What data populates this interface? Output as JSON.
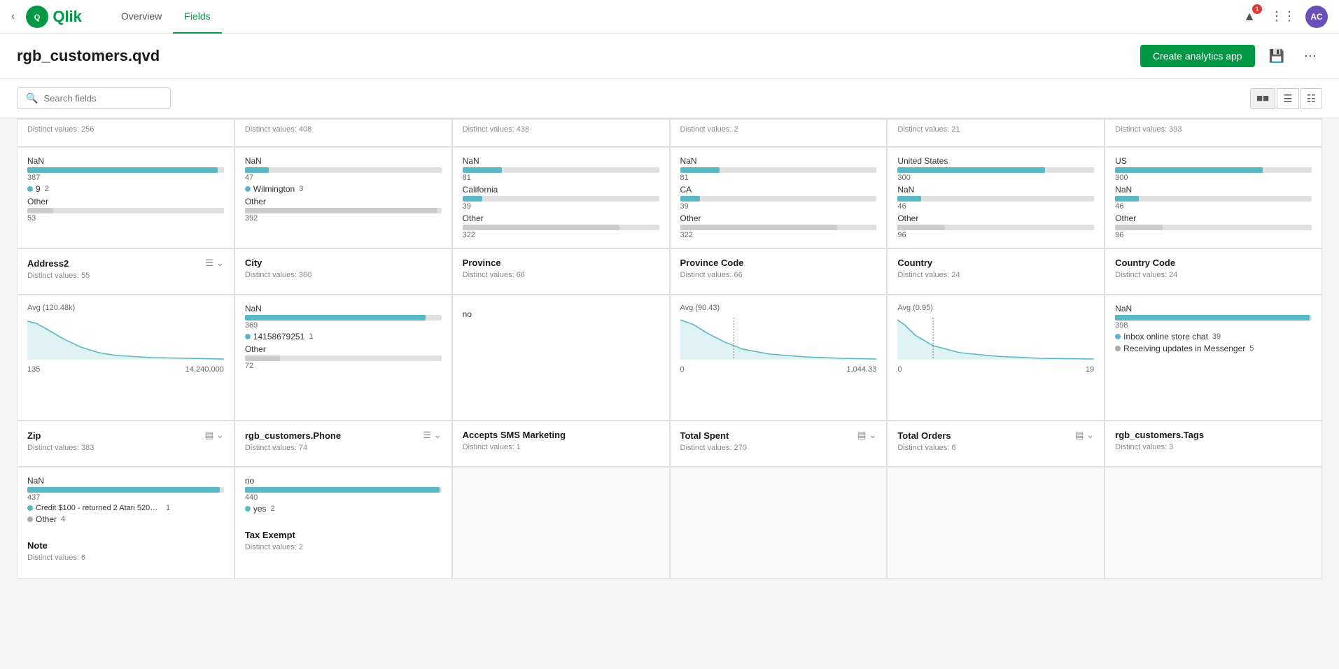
{
  "app": {
    "title": "rgb_customers.qvd"
  },
  "header": {
    "back_label": "‹",
    "logo_text": "Qlik",
    "logo_icon_text": "Q",
    "nav": [
      {
        "label": "Overview",
        "active": false
      },
      {
        "label": "Fields",
        "active": true
      }
    ],
    "notification_count": "1",
    "avatar_text": "AC"
  },
  "toolbar": {
    "search_placeholder": "Search fields",
    "create_analytics_label": "Create analytics app"
  },
  "fields": [
    {
      "name": "Address2",
      "distinct_label": "Distinct values: 55",
      "type": "text",
      "values": [
        {
          "label": "NaN",
          "count": 387,
          "max": 400,
          "type": "bar"
        },
        {
          "label": "9",
          "count": 2,
          "type": "dot"
        },
        {
          "label": "Other",
          "count": 53,
          "type": "bar_gray"
        }
      ],
      "has_sort": true
    },
    {
      "name": "City",
      "distinct_label": "Distinct values: 360",
      "type": "text",
      "values": [
        {
          "label": "NaN",
          "count": 47,
          "type": "bar"
        },
        {
          "label": "Wilmington",
          "count": 3,
          "type": "dot"
        },
        {
          "label": "Other",
          "count": 392,
          "type": "bar_gray"
        }
      ],
      "has_sort": true
    },
    {
      "name": "Province",
      "distinct_label": "Distinct values: 66",
      "type": "text",
      "values": [
        {
          "label": "NaN",
          "count": 81,
          "type": "bar"
        },
        {
          "label": "California",
          "count": 39,
          "type": "bar_teal_small"
        },
        {
          "label": "Other",
          "count": 322,
          "type": "bar_gray"
        }
      ],
      "has_sort": true
    },
    {
      "name": "Province Code",
      "distinct_label": "Distinct values: 66",
      "type": "text",
      "values": [
        {
          "label": "NaN",
          "count": 81,
          "type": "bar"
        },
        {
          "label": "CA",
          "count": 39,
          "type": "bar_teal_small"
        },
        {
          "label": "Other",
          "count": 322,
          "type": "bar_gray"
        }
      ],
      "has_sort": true
    },
    {
      "name": "Country",
      "distinct_label": "Distinct values: 24",
      "type": "text",
      "values": [
        {
          "label": "United States",
          "count": 300,
          "type": "bar"
        },
        {
          "label": "NaN",
          "count": 46,
          "type": "bar_teal_small"
        },
        {
          "label": "Other",
          "count": 96,
          "type": "bar_gray"
        }
      ],
      "has_sort": true
    },
    {
      "name": "Country Code",
      "distinct_label": "Distinct values: 24",
      "type": "text",
      "values": [
        {
          "label": "US",
          "count": 300,
          "type": "bar"
        },
        {
          "label": "NaN",
          "count": 46,
          "type": "bar_teal_small"
        },
        {
          "label": "Other",
          "count": 96,
          "type": "bar_gray"
        }
      ],
      "has_sort": true
    },
    {
      "name": "Zip",
      "distinct_label": "Distinct values: 383",
      "type": "numeric",
      "avg": "Avg (120.48k)",
      "range_min": "135",
      "range_max": "14,240,000",
      "has_chart": true
    },
    {
      "name": "rgb_customers.Phone",
      "distinct_label": "Distinct values: 74",
      "type": "text",
      "values": [
        {
          "label": "NaN",
          "count": 369,
          "type": "bar"
        },
        {
          "label": "14158679251",
          "count": 1,
          "type": "dot"
        },
        {
          "label": "Other",
          "count": 72,
          "type": "bar_gray"
        }
      ],
      "has_sort": true
    },
    {
      "name": "Accepts SMS Marketing",
      "distinct_label": "Distinct values: 1",
      "type": "text",
      "values": [
        {
          "label": "no",
          "count": null,
          "type": "text_only"
        }
      ],
      "has_sort": false
    },
    {
      "name": "Total Spent",
      "distinct_label": "Distinct values: 270",
      "type": "numeric",
      "avg": "Avg (90.43)",
      "range_min": "0",
      "range_max": "1,044.33",
      "has_chart": true
    },
    {
      "name": "Total Orders",
      "distinct_label": "Distinct values: 6",
      "type": "numeric",
      "avg": "Avg (0.95)",
      "range_min": "0",
      "range_max": "19",
      "has_chart": true
    },
    {
      "name": "rgb_customers.Tags",
      "distinct_label": "Distinct values: 3",
      "type": "text",
      "values": [
        {
          "label": "NaN",
          "count": 398,
          "type": "bar"
        },
        {
          "label": "Inbox online store chat",
          "count": 39,
          "type": "dot"
        },
        {
          "label": "Receiving updates in Messenger",
          "count": 5,
          "type": "dot2"
        }
      ],
      "has_sort": false
    },
    {
      "name": "Note",
      "distinct_label": "Distinct values: 6",
      "type": "text",
      "values": [
        {
          "label": "NaN",
          "count": 437,
          "type": "bar"
        },
        {
          "label": "Credit $100 - returned 2 Atari 5200 original ...",
          "count": 1,
          "type": "dot"
        },
        {
          "label": "Other",
          "count": 4,
          "type": "dot2"
        }
      ],
      "has_sort": false
    },
    {
      "name": "Tax Exempt",
      "distinct_label": "Distinct values: 2",
      "type": "text",
      "values": [
        {
          "label": "no",
          "count": 440,
          "type": "bar"
        },
        {
          "label": "yes",
          "count": 2,
          "type": "dot"
        }
      ],
      "has_sort": false
    }
  ],
  "top_row": {
    "distinct_labels": [
      "Distinct values: 256",
      "Distinct values: 408",
      "Distinct values: 438",
      "Distinct values: 2",
      "Distinct values: 21",
      "Distinct values: 393"
    ]
  }
}
